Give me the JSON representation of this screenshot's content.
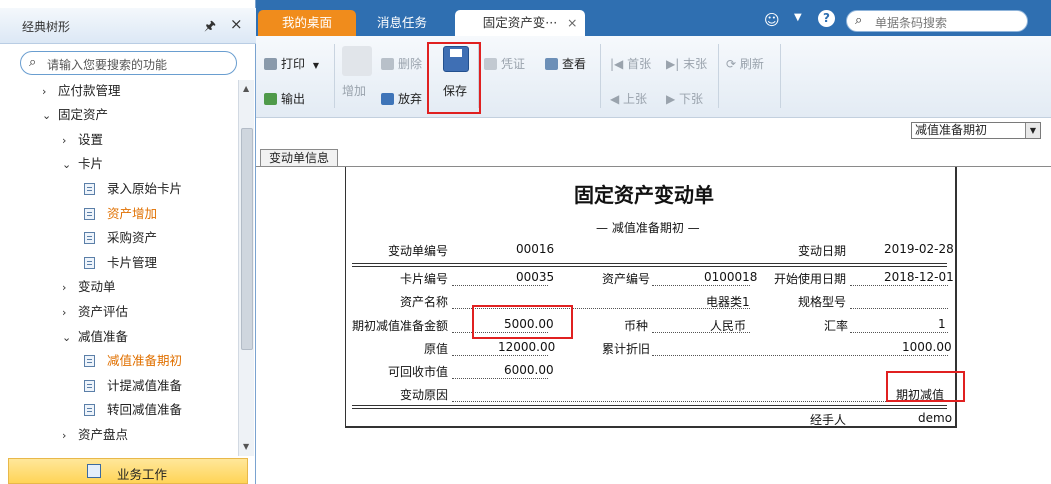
{
  "left_panel": {
    "title": "经典树形",
    "pin_icon": "pin-icon",
    "close_icon": "close-icon",
    "search_placeholder": "请输入您要搜索的功能",
    "tree": [
      {
        "label": "应付款管理",
        "arrow": "›",
        "type": "branch"
      },
      {
        "label": "固定资产",
        "arrow": "⌄",
        "type": "branch"
      },
      {
        "label": "设置",
        "arrow": "›",
        "type": "branch"
      },
      {
        "label": "卡片",
        "arrow": "⌄",
        "type": "branch"
      },
      {
        "label": "录入原始卡片",
        "type": "leaf"
      },
      {
        "label": "资产增加",
        "type": "leaf",
        "highlight": true
      },
      {
        "label": "采购资产",
        "type": "leaf"
      },
      {
        "label": "卡片管理",
        "type": "leaf"
      },
      {
        "label": "变动单",
        "arrow": "›",
        "type": "branch"
      },
      {
        "label": "资产评估",
        "arrow": "›",
        "type": "branch"
      },
      {
        "label": "减值准备",
        "arrow": "⌄",
        "type": "branch"
      },
      {
        "label": "减值准备期初",
        "type": "leaf",
        "highlight": true
      },
      {
        "label": "计提减值准备",
        "type": "leaf"
      },
      {
        "label": "转回减值准备",
        "type": "leaf"
      },
      {
        "label": "资产盘点",
        "arrow": "›",
        "type": "branch"
      }
    ],
    "business_bar": "业务工作"
  },
  "tabs": [
    {
      "label": "我的桌面"
    },
    {
      "label": "消息任务"
    },
    {
      "label": "固定资产变···",
      "close": "×"
    }
  ],
  "top_right": {
    "search_placeholder": "单据条码搜索"
  },
  "toolbar": {
    "print": "打印",
    "add": "增加",
    "delete": "删除",
    "save": "保存",
    "voucher": "凭证",
    "view": "查看",
    "first": "首张",
    "last": "末张",
    "refresh": "刷新",
    "export": "输出",
    "abandon": "放弃",
    "prev": "上张",
    "next": "下张"
  },
  "content": {
    "select_value": "减值准备期初",
    "subtab": "变动单信息",
    "doc": {
      "title": "固定资产变动单",
      "subtitle": "— 减值准备期初 —",
      "no_label": "变动单编号",
      "no_value": "00016",
      "date_label": "变动日期",
      "date_value": "2019-02-28",
      "card_no_label": "卡片编号",
      "card_no_value": "00035",
      "asset_no_label": "资产编号",
      "asset_no_value": "0100018",
      "start_date_label": "开始使用日期",
      "start_date_value": "2018-12-01",
      "asset_name_label": "资产名称",
      "asset_name_value": "电器类1",
      "spec_label": "规格型号",
      "spec_value": "",
      "impair_label": "期初减值准备金额",
      "impair_value": "5000.00",
      "currency_label": "币种",
      "currency_value": "人民币",
      "rate_label": "汇率",
      "rate_value": "1",
      "orig_label": "原值",
      "orig_value": "12000.00",
      "depr_label": "累计折旧",
      "depr_value": "1000.00",
      "recover_label": "可回收市值",
      "recover_value": "6000.00",
      "reason_label": "变动原因",
      "reason_value": "期初减值",
      "handler_label": "经手人",
      "handler_value": "demo"
    }
  }
}
